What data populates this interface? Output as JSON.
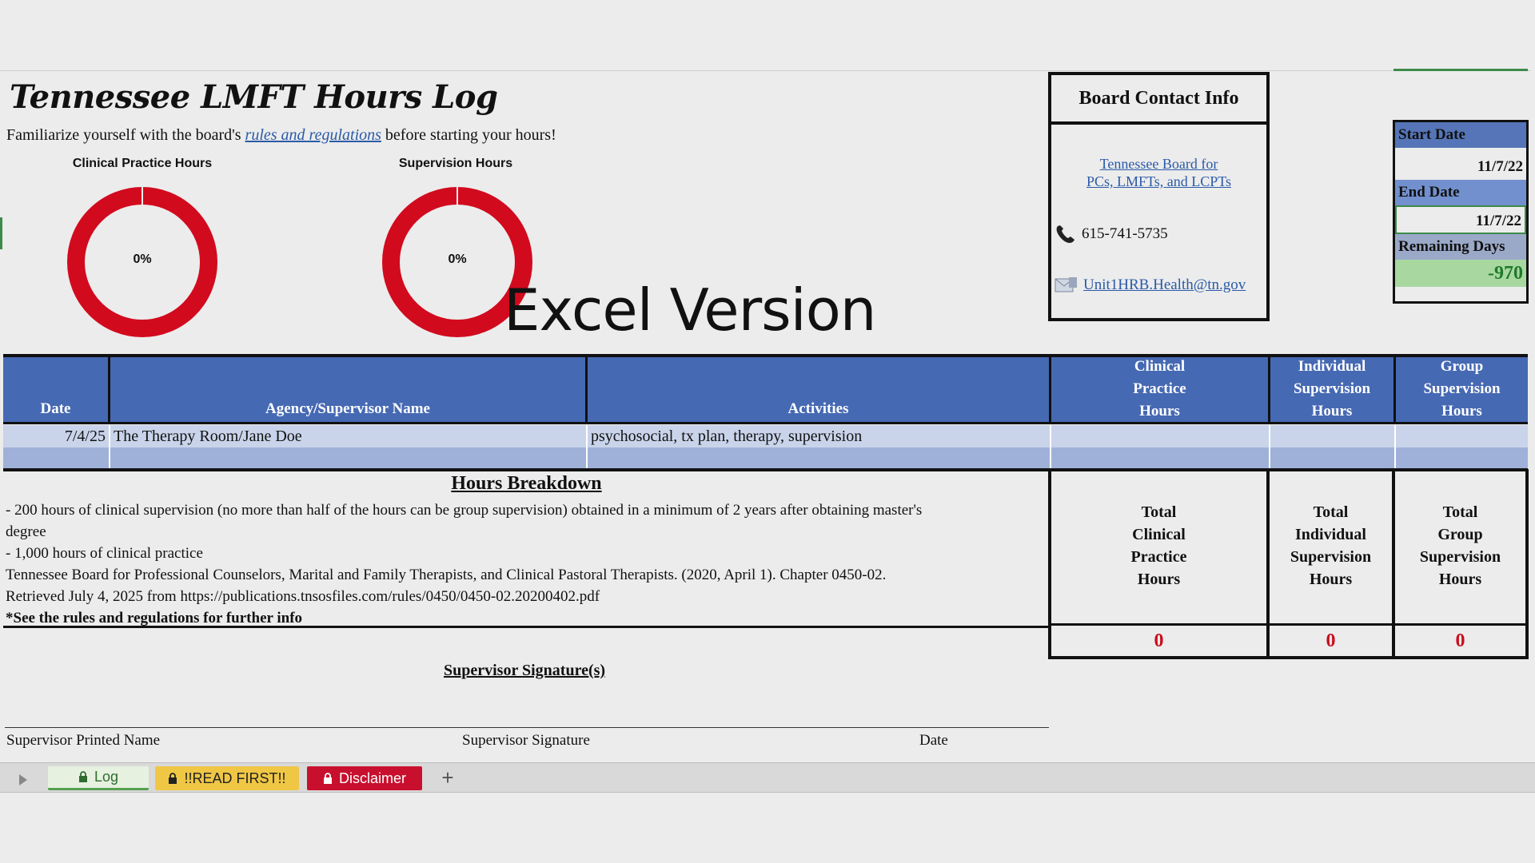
{
  "header": {
    "title": "Tennessee LMFT Hours Log",
    "subtitle_before": "Familiarize yourself with the board's ",
    "subtitle_link": "rules and regulations",
    "subtitle_after": " before starting your hours!"
  },
  "charts": {
    "clinical": {
      "title": "Clinical Practice Hours",
      "label": "0%",
      "percent": 0,
      "ring_color": "#d20a1e"
    },
    "supervision": {
      "title": "Supervision Hours",
      "label": "0%",
      "percent": 0,
      "ring_color": "#d20a1e"
    }
  },
  "overlay_text": "Excel Version",
  "board": {
    "title": "Board Contact Info",
    "link_line1": "Tennessee Board for",
    "link_line2": "PCs, LMFTs, and LCPTs",
    "phone": "615-741-5735",
    "email": "Unit1HRB.Health@tn.gov"
  },
  "dates": {
    "start_label": "Start Date",
    "start_value": "11/7/22",
    "end_label": "End Date",
    "end_value": "11/7/22",
    "remaining_label": "Remaining Days",
    "remaining_value": "-970"
  },
  "table": {
    "headers": {
      "date": "Date",
      "agency": "Agency/Supervisor Name",
      "activities": "Activities",
      "clinical_l1": "Clinical",
      "clinical_l2": "Practice",
      "clinical_l3": "Hours",
      "individual_l1": "Individual",
      "individual_l2": "Supervision",
      "individual_l3": "Hours",
      "group_l1": "Group",
      "group_l2": "Supervision",
      "group_l3": "Hours"
    },
    "rows": [
      {
        "date": "7/4/25",
        "agency": "The Therapy Room/Jane Doe",
        "activities": "psychosocial, tx plan, therapy, supervision",
        "clinical": "",
        "individual": "",
        "group": ""
      },
      {
        "date": "",
        "agency": "",
        "activities": "",
        "clinical": "",
        "individual": "",
        "group": ""
      }
    ]
  },
  "breakdown": {
    "title": "Hours Breakdown",
    "line1": "- 200 hours of clinical supervision (no more than half of the hours can be group supervision) obtained in a minimum of 2 years after obtaining master's",
    "line1b": "degree",
    "line2": "- 1,000 hours of clinical practice",
    "line3": "Tennessee Board for Professional Counselors, Marital and Family Therapists, and Clinical Pastoral Therapists. (2020, April 1). Chapter 0450-02.",
    "line4": "Retrieved July 4, 2025 from https://publications.tnsosfiles.com/rules/0450/0450-02.20200402.pdf",
    "line5": "*See the rules and regulations for further info"
  },
  "totals": {
    "clinical_l1": "Total",
    "clinical_l2": "Clinical",
    "clinical_l3": "Practice",
    "clinical_l4": "Hours",
    "individual_l1": "Total",
    "individual_l2": "Individual",
    "individual_l3": "Supervision",
    "individual_l4": "Hours",
    "group_l1": "Total",
    "group_l2": "Group",
    "group_l3": "Supervision",
    "group_l4": "Hours",
    "clinical_value": "0",
    "individual_value": "0",
    "group_value": "0"
  },
  "signature": {
    "title": "Supervisor Signature(s)",
    "printed_name": "Supervisor Printed Name",
    "signature": "Supervisor Signature",
    "date": "Date"
  },
  "tabs": {
    "log": "Log",
    "read_first": "!!READ FIRST!!",
    "disclaimer": "Disclaimer",
    "add": "+"
  }
}
